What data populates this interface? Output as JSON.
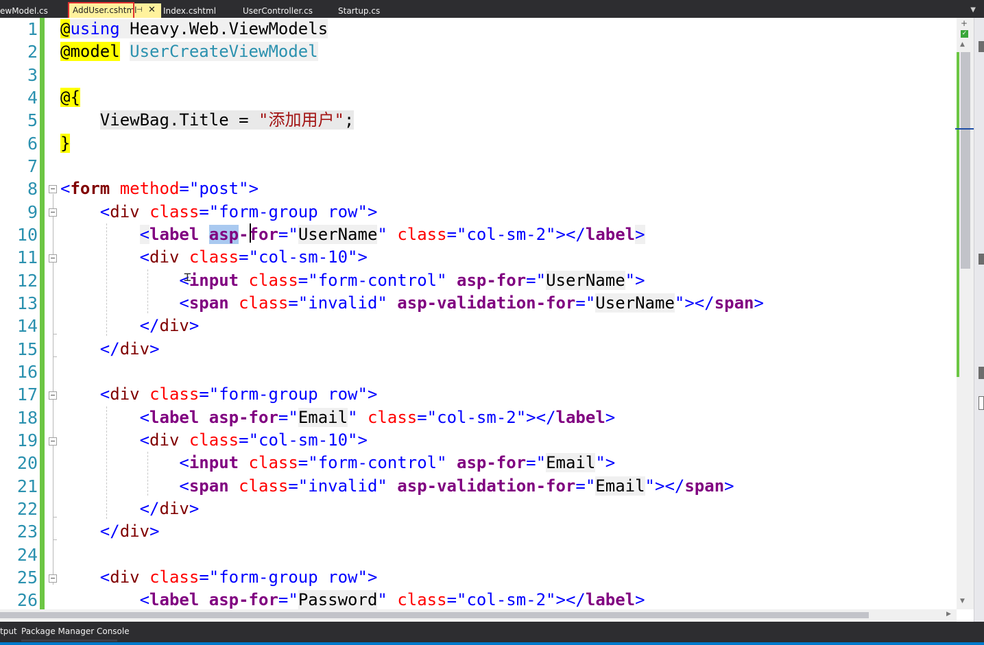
{
  "tabs": [
    {
      "label": "ewModel.cs",
      "active": false
    },
    {
      "label": "AddUser.cshtml",
      "active": true
    },
    {
      "label": "Index.cshtml",
      "active": false
    },
    {
      "label": "UserController.cs",
      "active": false
    },
    {
      "label": "Startup.cs",
      "active": false
    }
  ],
  "tab_icons": {
    "pin": "pin-icon",
    "close": "close-icon",
    "dropdown": "chevron-down-icon"
  },
  "line_numbers": [
    "1",
    "2",
    "3",
    "4",
    "5",
    "6",
    "7",
    "8",
    "9",
    "10",
    "11",
    "12",
    "13",
    "14",
    "15",
    "16",
    "17",
    "18",
    "19",
    "20",
    "21",
    "22",
    "23",
    "24",
    "25",
    "26"
  ],
  "code": {
    "l1": {
      "at": "@",
      "using": "using",
      "ns": " Heavy.Web.ViewModels"
    },
    "l2": {
      "model": "@model",
      "type": "UserCreateViewModel"
    },
    "l4": {
      "open": "@{"
    },
    "l5": {
      "lhs": "ViewBag.Title",
      "op": " = ",
      "str": "\"添加用户\"",
      "end": ";"
    },
    "l6": {
      "close": "}"
    },
    "l8": {
      "open": "<",
      "tag": "form",
      "attr": "method",
      "eq": "=",
      "q1": "\"",
      "val": "post",
      "q2": "\"",
      "close": ">"
    },
    "l9": {
      "open": "<",
      "tag": "div",
      "attr": "class",
      "eq": "=",
      "str": "\"form-group row\"",
      "close": ">"
    },
    "l10": {
      "open": "<",
      "tag": "label",
      "sel": "asp",
      "tth": "-for",
      "eq": "=",
      "q1": "\"",
      "val": "UserName",
      "q2": "\"",
      "attr": "class",
      "eq2": "=",
      "str": "\"col-sm-2\"",
      "mid": "></",
      "tag2": "label",
      "close": ">"
    },
    "l11": {
      "open": "<",
      "tag": "div",
      "attr": "class",
      "eq": "=",
      "str": "\"col-sm-10\"",
      "close": ">"
    },
    "l12": {
      "open": "<",
      "tag": "input",
      "attr": "class",
      "eq": "=",
      "str": "\"form-control\"",
      "tth": "asp-for",
      "eq2": "=",
      "q1": "\"",
      "val": "UserName",
      "q2": "\"",
      "close": ">"
    },
    "l13": {
      "open": "<",
      "tag": "span",
      "attr": "class",
      "eq": "=",
      "str": "\"invalid\"",
      "tth": "asp-validation-for",
      "eq2": "=",
      "q1": "\"",
      "val": "UserName",
      "q2": "\"",
      "mid": "></",
      "tag2": "span",
      "close": ">"
    },
    "l14": {
      "open": "</",
      "tag": "div",
      "close": ">"
    },
    "l15": {
      "open": "</",
      "tag": "div",
      "close": ">"
    },
    "l17": {
      "open": "<",
      "tag": "div",
      "attr": "class",
      "eq": "=",
      "str": "\"form-group row\"",
      "close": ">"
    },
    "l18": {
      "open": "<",
      "tag": "label",
      "tth": "asp-for",
      "eq": "=",
      "q1": "\"",
      "val": "Email",
      "q2": "\"",
      "attr": "class",
      "eq2": "=",
      "str": "\"col-sm-2\"",
      "mid": "></",
      "tag2": "label",
      "close": ">"
    },
    "l19": {
      "open": "<",
      "tag": "div",
      "attr": "class",
      "eq": "=",
      "str": "\"col-sm-10\"",
      "close": ">"
    },
    "l20": {
      "open": "<",
      "tag": "input",
      "attr": "class",
      "eq": "=",
      "str": "\"form-control\"",
      "tth": "asp-for",
      "eq2": "=",
      "q1": "\"",
      "val": "Email",
      "q2": "\"",
      "close": ">"
    },
    "l21": {
      "open": "<",
      "tag": "span",
      "attr": "class",
      "eq": "=",
      "str": "\"invalid\"",
      "tth": "asp-validation-for",
      "eq2": "=",
      "q1": "\"",
      "val": "Email",
      "q2": "\"",
      "mid": "></",
      "tag2": "span",
      "close": ">"
    },
    "l22": {
      "open": "</",
      "tag": "div",
      "close": ">"
    },
    "l23": {
      "open": "</",
      "tag": "div",
      "close": ">"
    },
    "l25": {
      "open": "<",
      "tag": "div",
      "attr": "class",
      "eq": "=",
      "str": "\"form-group row\"",
      "close": ">"
    },
    "l26": {
      "open": "<",
      "tag": "label",
      "tth": "asp-for",
      "eq": "=",
      "q1": "\"",
      "val": "Password",
      "q2": "\"",
      "attr": "class",
      "eq2": "=",
      "str": "\"col-sm-2\"",
      "mid": "></",
      "tag2": "label",
      "close": ">"
    }
  },
  "scrollbar": {
    "split_label": "+",
    "check_label": "✓",
    "up_label": "▲",
    "down_label": "▼",
    "right_label": "▶"
  },
  "bottom_tabs": [
    {
      "label": "tput"
    },
    {
      "label": "Package Manager Console"
    }
  ],
  "colors": {
    "accent": "#007acc",
    "active_tab": "#fff29d",
    "change_bar": "#6cc644",
    "chrome": "#2d2d30"
  }
}
